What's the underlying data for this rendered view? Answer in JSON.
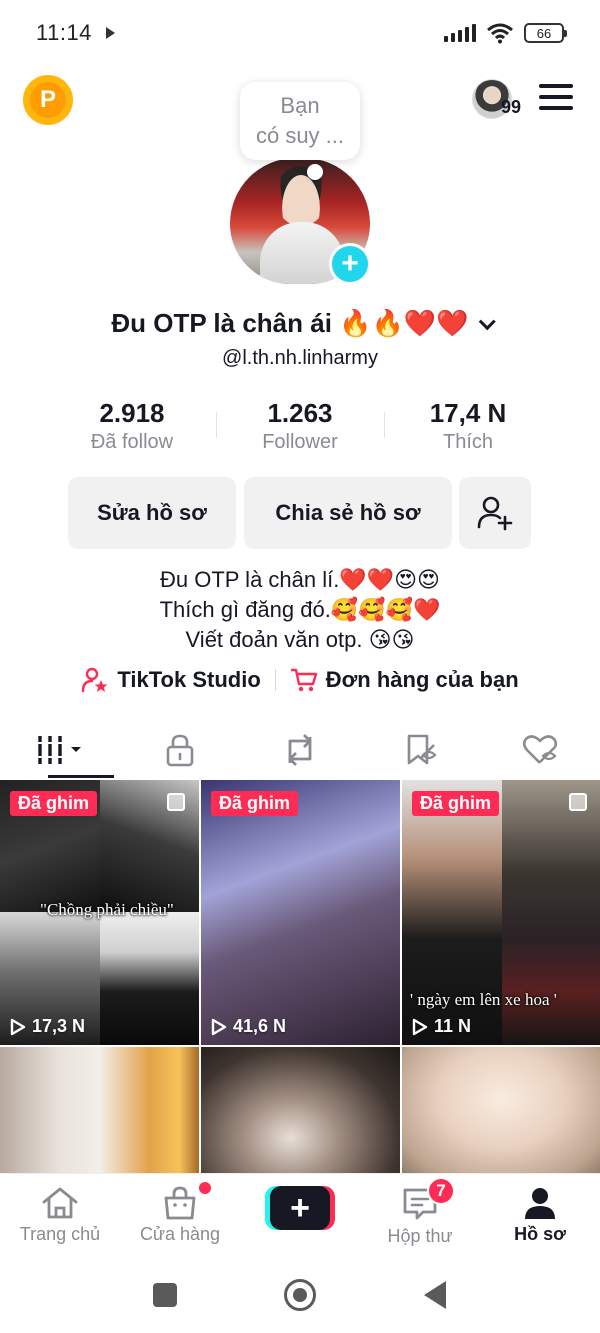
{
  "status_bar": {
    "time": "11:14",
    "battery": "66",
    "icons": [
      "play-icon",
      "signal-icon",
      "wifi-icon",
      "battery-icon"
    ]
  },
  "top_bar": {
    "coin_letter": "P",
    "story_count": "99",
    "icons": [
      "coin-icon",
      "avatar-icon",
      "menu-icon"
    ]
  },
  "note": {
    "line1": "Bạn",
    "line2": "có suy ..."
  },
  "profile": {
    "name": "Đu OTP là chân ái 🔥🔥❤️❤️",
    "username": "@l.th.nh.linharmy"
  },
  "stats": [
    {
      "value": "2.918",
      "label": "Đã follow"
    },
    {
      "value": "1.263",
      "label": "Follower"
    },
    {
      "value": "17,4 N",
      "label": "Thích"
    }
  ],
  "buttons": {
    "edit": "Sửa hồ sơ",
    "share": "Chia sẻ hồ sơ"
  },
  "bio": {
    "line1": "Đu OTP là chân lí.❤️❤️😍😍",
    "line2": "Thích gì đăng đó.🥰🥰🥰❤️",
    "line3": "Viết đoản văn otp. 😘😘"
  },
  "links": {
    "studio": "TikTok Studio",
    "orders": "Đơn hàng của bạn"
  },
  "tabs": [
    "videos-grid-icon",
    "lock-icon",
    "repost-icon",
    "favorites-icon",
    "liked-icon"
  ],
  "videos": [
    {
      "badge": "Đã ghim",
      "views": "17,3 N",
      "caption": "\"Chồng phải chiều\""
    },
    {
      "badge": "Đã ghim",
      "views": "41,6 N",
      "caption": ""
    },
    {
      "badge": "Đã ghim",
      "views": "11 N",
      "caption": "' ngày em lên xe hoa '"
    }
  ],
  "bottom_nav": {
    "home": "Trang chủ",
    "shop": "Cửa hàng",
    "inbox": "Hộp thư",
    "inbox_badge": "7",
    "profile": "Hồ sơ"
  },
  "colors": {
    "accent": "#fe2c55",
    "cyan": "#25f4ee",
    "text": "#161823",
    "muted": "#8a8b91"
  }
}
